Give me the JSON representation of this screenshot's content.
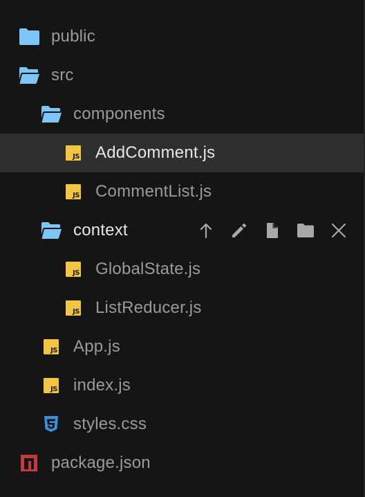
{
  "tree": {
    "items": [
      {
        "label": "public",
        "icon": "folder-closed-icon"
      },
      {
        "label": "src",
        "icon": "folder-open-icon"
      },
      {
        "label": "components",
        "icon": "folder-open-icon"
      },
      {
        "label": "AddComment.js",
        "icon": "javascript-file-icon",
        "selected": true
      },
      {
        "label": "CommentList.js",
        "icon": "javascript-file-icon"
      },
      {
        "label": "context",
        "icon": "folder-open-icon",
        "hovered": true
      },
      {
        "label": "GlobalState.js",
        "icon": "javascript-file-icon"
      },
      {
        "label": "ListReducer.js",
        "icon": "javascript-file-icon"
      },
      {
        "label": "App.js",
        "icon": "javascript-file-icon"
      },
      {
        "label": "index.js",
        "icon": "javascript-file-icon"
      },
      {
        "label": "styles.css",
        "icon": "css3-file-icon"
      },
      {
        "label": "package.json",
        "icon": "npm-package-icon"
      }
    ],
    "js_badge": "JS"
  },
  "row_actions": [
    "upload-icon",
    "rename-pencil-icon",
    "new-file-icon",
    "new-folder-icon",
    "delete-close-icon"
  ],
  "colors": {
    "background": "#151515",
    "selected_row": "#2f2f2f",
    "folder": "#7cc7f7",
    "js_badge": "#f4c542",
    "css": "#3f8fd8",
    "npm": "#c23b3b",
    "text_dim": "#9a9a9a",
    "text_bright": "#e6e6e6",
    "action_icon": "#a8a8a8"
  }
}
